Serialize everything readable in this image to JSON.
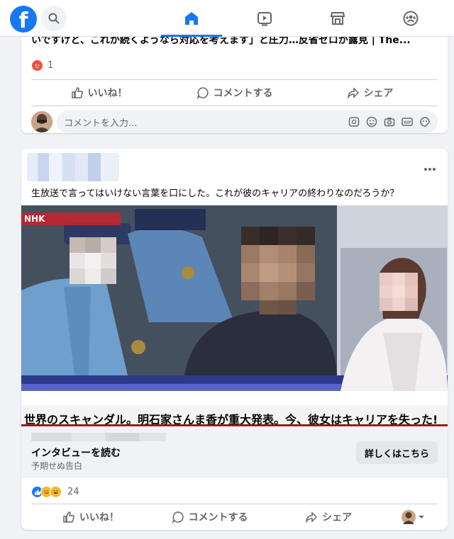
{
  "nav": {
    "logo": "f",
    "tabs": [
      "home",
      "video",
      "marketplace",
      "groups"
    ],
    "active_tab": "home"
  },
  "post1": {
    "title": "いですけど、これが続くようなら対応を考えます」と圧力…反省ゼロが露見 | The...",
    "reaction_count": "1",
    "actions": {
      "like": "いいね！",
      "comment": "コメントする",
      "share": "シェア"
    },
    "comment_placeholder": "コメントを入力..."
  },
  "post2": {
    "text": "生放送で言ってはいけない言葉を口にした。これが彼のキャリアの終わりなのだろうか？",
    "media_watermark": "NHK",
    "headline": "世界のスキャンダル。明石家さんま香が重大発表。今、彼女はキャリアを失った!",
    "link_title": "インタビューを読む",
    "link_subtitle": "予期せぬ告白",
    "learn_more": "詳しくはこちら",
    "reaction_count": "24",
    "actions": {
      "like": "いいね！",
      "comment": "コメントする",
      "share": "シェア"
    }
  },
  "colors": {
    "brand": "#1877f2",
    "headline_underline": "#9b1b20"
  }
}
